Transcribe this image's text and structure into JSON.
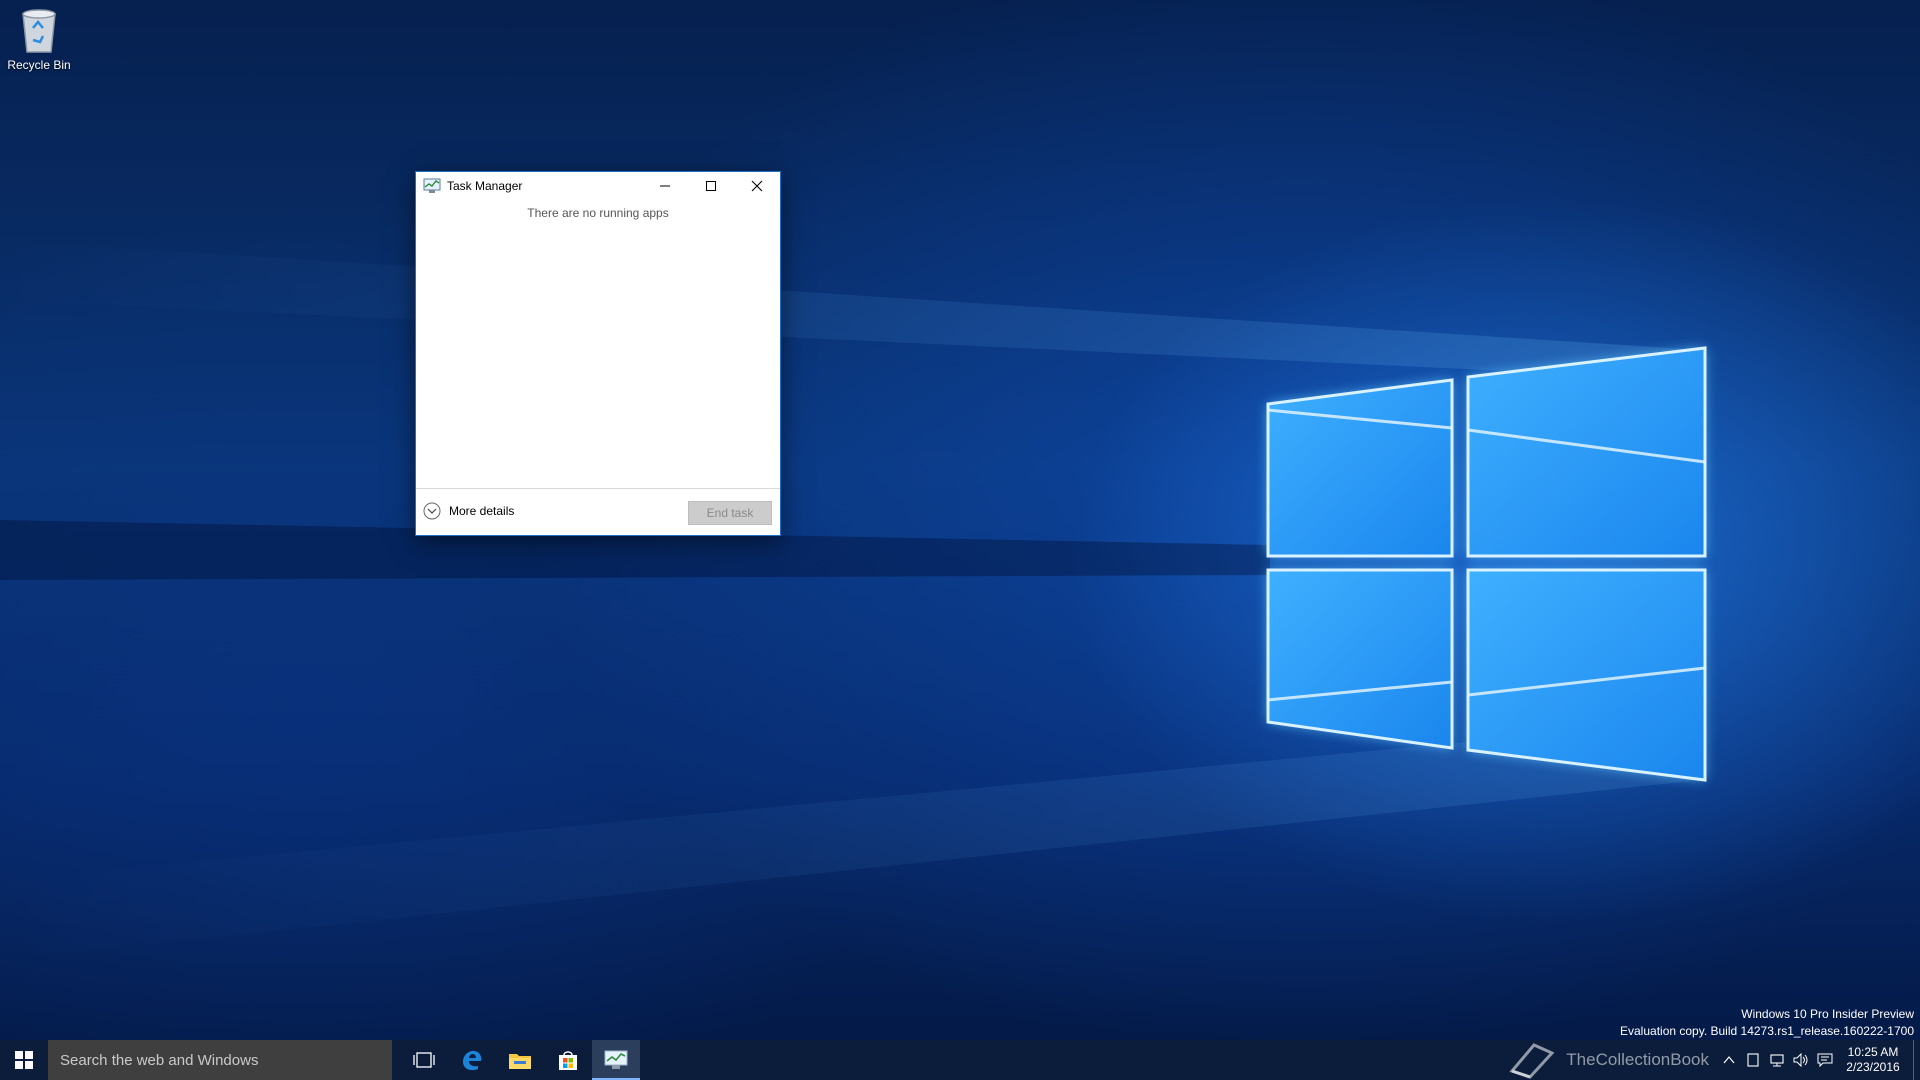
{
  "desktop": {
    "icons": [
      {
        "label": "Recycle Bin",
        "icon": "recycle-bin-icon"
      }
    ]
  },
  "task_manager": {
    "title": "Task Manager",
    "empty_message": "There are no running apps",
    "more_details_label": "More details",
    "end_task_label": "End task",
    "end_task_enabled": false
  },
  "watermark": {
    "line1": "Windows 10 Pro Insider Preview",
    "line2": "Evaluation copy. Build 14273.rs1_release.160222-1700"
  },
  "taskbar": {
    "search_placeholder": "Search the web and Windows",
    "pinned": [
      {
        "name": "task-view",
        "icon": "task-view-icon"
      },
      {
        "name": "edge",
        "icon": "edge-icon"
      },
      {
        "name": "file-explorer",
        "icon": "folder-icon"
      },
      {
        "name": "store",
        "icon": "store-icon"
      },
      {
        "name": "task-manager",
        "icon": "task-manager-icon",
        "active": true
      }
    ],
    "tray_brand": "TheCollectionBook",
    "clock_time": "10:25 AM",
    "clock_date": "2/23/2016"
  },
  "colors": {
    "taskbar": "#0b1d3a",
    "search_box": "#3f3f3f",
    "window_border": "#1f6fc4",
    "active_indicator": "#7db3ff"
  }
}
